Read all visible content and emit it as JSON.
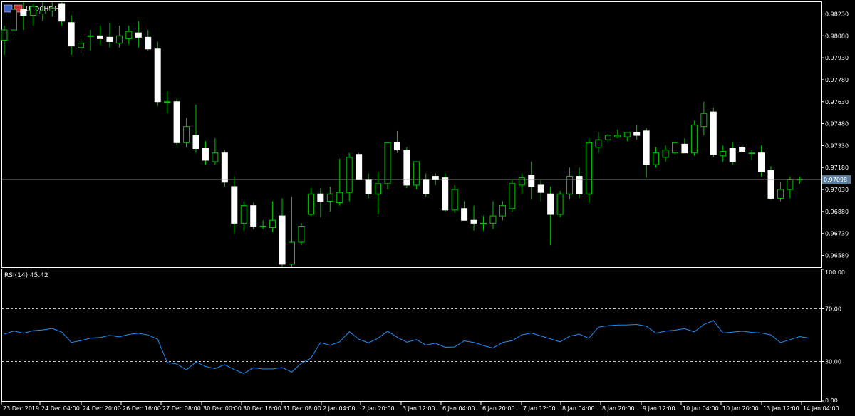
{
  "window": {
    "title": "USDCHF,H4"
  },
  "indicator": {
    "label": "RSI(14) 45.42"
  },
  "colors": {
    "background": "#000000",
    "bull_wick": "#00c800",
    "bear_fill": "#ffffff",
    "rsi_line": "#1e90ff",
    "price_line": "#a0a0a0",
    "price_tag": "#5f7f9f"
  },
  "chart_data": [
    {
      "type": "candlestick",
      "title": "USDCHF,H4",
      "ylim": [
        0.965,
        0.9831
      ],
      "yticks": [
        {
          "value": 0.9823,
          "label": "0.98230"
        },
        {
          "value": 0.9808,
          "label": "0.98080"
        },
        {
          "value": 0.9793,
          "label": "0.97930"
        },
        {
          "value": 0.9778,
          "label": "0.97780"
        },
        {
          "value": 0.9763,
          "label": "0.97630"
        },
        {
          "value": 0.9748,
          "label": "0.97480"
        },
        {
          "value": 0.9733,
          "label": "0.97330"
        },
        {
          "value": 0.9718,
          "label": "0.97180"
        },
        {
          "value": 0.9703,
          "label": "0.97030"
        },
        {
          "value": 0.9688,
          "label": "0.96880"
        },
        {
          "value": 0.9673,
          "label": "0.96730"
        },
        {
          "value": 0.9658,
          "label": "0.96580"
        }
      ],
      "current_price": {
        "value": 0.97098,
        "label": "0.97098"
      },
      "x_labels": [
        "23 Dec 2019",
        "24 Dec 04:00",
        "24 Dec 20:00",
        "26 Dec 16:00",
        "27 Dec 08:00",
        "30 Dec 00:00",
        "30 Dec 16:00",
        "31 Dec 08:00",
        "2 Jan 04:00",
        "2 Jan 20:00",
        "3 Jan 12:00",
        "6 Jan 04:00",
        "6 Jan 20:00",
        "7 Jan 12:00",
        "8 Jan 04:00",
        "8 Jan 20:00",
        "9 Jan 12:00",
        "10 Jan 04:00",
        "10 Jan 20:00",
        "13 Jan 12:00",
        "14 Jan 04:00"
      ],
      "candles": [
        {
          "o": 0.9805,
          "h": 0.9815,
          "l": 0.9795,
          "c": 0.9812
        },
        {
          "o": 0.9812,
          "h": 0.983,
          "l": 0.9808,
          "c": 0.9826
        },
        {
          "o": 0.9826,
          "h": 0.9831,
          "l": 0.9812,
          "c": 0.9822
        },
        {
          "o": 0.9822,
          "h": 0.983,
          "l": 0.9815,
          "c": 0.9828
        },
        {
          "o": 0.9823,
          "h": 0.9831,
          "l": 0.9818,
          "c": 0.9825
        },
        {
          "o": 0.9825,
          "h": 0.9831,
          "l": 0.9821,
          "c": 0.9827
        },
        {
          "o": 0.983,
          "h": 0.9831,
          "l": 0.9815,
          "c": 0.9818
        },
        {
          "o": 0.9817,
          "h": 0.9822,
          "l": 0.9795,
          "c": 0.9801
        },
        {
          "o": 0.98,
          "h": 0.9806,
          "l": 0.9796,
          "c": 0.9803
        },
        {
          "o": 0.9808,
          "h": 0.9812,
          "l": 0.9798,
          "c": 0.9808
        },
        {
          "o": 0.9808,
          "h": 0.9815,
          "l": 0.9802,
          "c": 0.9806
        },
        {
          "o": 0.9807,
          "h": 0.9817,
          "l": 0.98,
          "c": 0.9804
        },
        {
          "o": 0.9803,
          "h": 0.9815,
          "l": 0.98,
          "c": 0.9808
        },
        {
          "o": 0.9806,
          "h": 0.9815,
          "l": 0.9802,
          "c": 0.9811
        },
        {
          "o": 0.981,
          "h": 0.9818,
          "l": 0.98,
          "c": 0.9807
        },
        {
          "o": 0.9807,
          "h": 0.9812,
          "l": 0.9798,
          "c": 0.9799
        },
        {
          "o": 0.9799,
          "h": 0.9804,
          "l": 0.976,
          "c": 0.9763
        },
        {
          "o": 0.9763,
          "h": 0.977,
          "l": 0.9755,
          "c": 0.9763
        },
        {
          "o": 0.9763,
          "h": 0.9765,
          "l": 0.9733,
          "c": 0.9735
        },
        {
          "o": 0.9735,
          "h": 0.9752,
          "l": 0.9732,
          "c": 0.9746
        },
        {
          "o": 0.974,
          "h": 0.9761,
          "l": 0.9728,
          "c": 0.9731
        },
        {
          "o": 0.9731,
          "h": 0.9736,
          "l": 0.972,
          "c": 0.9723
        },
        {
          "o": 0.9722,
          "h": 0.9738,
          "l": 0.972,
          "c": 0.9728
        },
        {
          "o": 0.9728,
          "h": 0.973,
          "l": 0.9705,
          "c": 0.9708
        },
        {
          "o": 0.9705,
          "h": 0.9712,
          "l": 0.9673,
          "c": 0.968
        },
        {
          "o": 0.968,
          "h": 0.9695,
          "l": 0.9675,
          "c": 0.9692
        },
        {
          "o": 0.9692,
          "h": 0.9694,
          "l": 0.9676,
          "c": 0.9678
        },
        {
          "o": 0.9678,
          "h": 0.9682,
          "l": 0.9676,
          "c": 0.9678
        },
        {
          "o": 0.9677,
          "h": 0.9695,
          "l": 0.9674,
          "c": 0.9682
        },
        {
          "o": 0.9685,
          "h": 0.9697,
          "l": 0.965,
          "c": 0.9652
        },
        {
          "o": 0.9652,
          "h": 0.9698,
          "l": 0.965,
          "c": 0.9667
        },
        {
          "o": 0.9667,
          "h": 0.968,
          "l": 0.9665,
          "c": 0.9678
        },
        {
          "o": 0.9686,
          "h": 0.9704,
          "l": 0.9685,
          "c": 0.97
        },
        {
          "o": 0.97,
          "h": 0.9704,
          "l": 0.9684,
          "c": 0.9695
        },
        {
          "o": 0.9695,
          "h": 0.9705,
          "l": 0.9688,
          "c": 0.97
        },
        {
          "o": 0.9694,
          "h": 0.9724,
          "l": 0.9692,
          "c": 0.9701
        },
        {
          "o": 0.9701,
          "h": 0.9728,
          "l": 0.9695,
          "c": 0.9725
        },
        {
          "o": 0.9727,
          "h": 0.9728,
          "l": 0.971,
          "c": 0.971
        },
        {
          "o": 0.971,
          "h": 0.9714,
          "l": 0.9697,
          "c": 0.97
        },
        {
          "o": 0.97,
          "h": 0.9715,
          "l": 0.9686,
          "c": 0.9707
        },
        {
          "o": 0.9707,
          "h": 0.973,
          "l": 0.9703,
          "c": 0.9735
        },
        {
          "o": 0.9735,
          "h": 0.9743,
          "l": 0.9728,
          "c": 0.973
        },
        {
          "o": 0.973,
          "h": 0.9732,
          "l": 0.9704,
          "c": 0.9706
        },
        {
          "o": 0.9706,
          "h": 0.9722,
          "l": 0.9703,
          "c": 0.9722
        },
        {
          "o": 0.971,
          "h": 0.9714,
          "l": 0.9698,
          "c": 0.97
        },
        {
          "o": 0.9712,
          "h": 0.9714,
          "l": 0.9706,
          "c": 0.971
        },
        {
          "o": 0.9711,
          "h": 0.9714,
          "l": 0.9688,
          "c": 0.9689
        },
        {
          "o": 0.9689,
          "h": 0.9706,
          "l": 0.9687,
          "c": 0.9703
        },
        {
          "o": 0.969,
          "h": 0.9695,
          "l": 0.9682,
          "c": 0.9682
        },
        {
          "o": 0.9682,
          "h": 0.9692,
          "l": 0.9675,
          "c": 0.968
        },
        {
          "o": 0.968,
          "h": 0.9685,
          "l": 0.9675,
          "c": 0.968
        },
        {
          "o": 0.968,
          "h": 0.9695,
          "l": 0.9676,
          "c": 0.9685
        },
        {
          "o": 0.9685,
          "h": 0.9695,
          "l": 0.9682,
          "c": 0.9692
        },
        {
          "o": 0.969,
          "h": 0.971,
          "l": 0.9688,
          "c": 0.9707
        },
        {
          "o": 0.9706,
          "h": 0.9714,
          "l": 0.97,
          "c": 0.9711
        },
        {
          "o": 0.9713,
          "h": 0.9722,
          "l": 0.9696,
          "c": 0.9705
        },
        {
          "o": 0.9706,
          "h": 0.971,
          "l": 0.9695,
          "c": 0.9701
        },
        {
          "o": 0.97,
          "h": 0.9705,
          "l": 0.9665,
          "c": 0.9686
        },
        {
          "o": 0.9686,
          "h": 0.9702,
          "l": 0.9684,
          "c": 0.97
        },
        {
          "o": 0.97,
          "h": 0.9718,
          "l": 0.9696,
          "c": 0.9712
        },
        {
          "o": 0.9712,
          "h": 0.9718,
          "l": 0.9697,
          "c": 0.97
        },
        {
          "o": 0.97,
          "h": 0.9738,
          "l": 0.9694,
          "c": 0.9735
        },
        {
          "o": 0.9732,
          "h": 0.9742,
          "l": 0.9728,
          "c": 0.9737
        },
        {
          "o": 0.9737,
          "h": 0.9741,
          "l": 0.9735,
          "c": 0.974
        },
        {
          "o": 0.9739,
          "h": 0.9744,
          "l": 0.9738,
          "c": 0.974
        },
        {
          "o": 0.9739,
          "h": 0.9741,
          "l": 0.9736,
          "c": 0.9742
        },
        {
          "o": 0.9742,
          "h": 0.9747,
          "l": 0.9737,
          "c": 0.974
        },
        {
          "o": 0.9743,
          "h": 0.9745,
          "l": 0.9711,
          "c": 0.972
        },
        {
          "o": 0.972,
          "h": 0.9732,
          "l": 0.9718,
          "c": 0.9728
        },
        {
          "o": 0.9725,
          "h": 0.9733,
          "l": 0.9722,
          "c": 0.973
        },
        {
          "o": 0.9728,
          "h": 0.9737,
          "l": 0.9727,
          "c": 0.9735
        },
        {
          "o": 0.9734,
          "h": 0.9738,
          "l": 0.9728,
          "c": 0.9728
        },
        {
          "o": 0.9728,
          "h": 0.975,
          "l": 0.9726,
          "c": 0.9747
        },
        {
          "o": 0.9746,
          "h": 0.9763,
          "l": 0.974,
          "c": 0.9755
        },
        {
          "o": 0.9756,
          "h": 0.9759,
          "l": 0.9725,
          "c": 0.9727
        },
        {
          "o": 0.9726,
          "h": 0.9733,
          "l": 0.9722,
          "c": 0.9729
        },
        {
          "o": 0.9731,
          "h": 0.9735,
          "l": 0.972,
          "c": 0.9722
        },
        {
          "o": 0.9732,
          "h": 0.9733,
          "l": 0.9728,
          "c": 0.9729
        },
        {
          "o": 0.9728,
          "h": 0.973,
          "l": 0.9723,
          "c": 0.9728
        },
        {
          "o": 0.9728,
          "h": 0.9733,
          "l": 0.9712,
          "c": 0.9715
        },
        {
          "o": 0.9716,
          "h": 0.9719,
          "l": 0.9696,
          "c": 0.9697
        },
        {
          "o": 0.9697,
          "h": 0.9708,
          "l": 0.9695,
          "c": 0.9703
        },
        {
          "o": 0.9703,
          "h": 0.9712,
          "l": 0.9697,
          "c": 0.971
        },
        {
          "o": 0.971,
          "h": 0.9712,
          "l": 0.9707,
          "c": 0.971
        }
      ]
    },
    {
      "type": "line",
      "title": "RSI(14) 45.42",
      "ylim": [
        0,
        100
      ],
      "yticks": [
        {
          "value": 100,
          "label": "100.00"
        },
        {
          "value": 70,
          "label": "70.00"
        },
        {
          "value": 30,
          "label": "30.00"
        },
        {
          "value": 0,
          "label": "0.00"
        }
      ],
      "levels": [
        70,
        30
      ],
      "series": [
        {
          "values": [
            50.8,
            53.2,
            51.5,
            53.4,
            54.0,
            55.1,
            52.3,
            44.5,
            45.9,
            47.8,
            48.2,
            49.8,
            48.7,
            50.6,
            51.4,
            50.1,
            47.0,
            29.3,
            28.1,
            23.6,
            29.7,
            26.3,
            24.6,
            27.6,
            23.9,
            20.9,
            25.3,
            24.3,
            24.4,
            25.4,
            22.0,
            28.7,
            32.6,
            44.4,
            42.4,
            45.0,
            52.7,
            47.0,
            44.1,
            47.7,
            53.0,
            48.5,
            44.7,
            46.6,
            42.5,
            43.9,
            40.8,
            41.1,
            45.7,
            44.5,
            42.1,
            40.2,
            44.5,
            45.8,
            50.2,
            51.6,
            49.4,
            47.2,
            44.9,
            49.2,
            50.8,
            47.6,
            56.1,
            57.2,
            57.7,
            57.8,
            58.1,
            56.8,
            51.5,
            53.1,
            53.8,
            55.0,
            52.5,
            58.1,
            61.1,
            51.6,
            52.3,
            53.0,
            52.1,
            51.7,
            50.2,
            44.3,
            46.6,
            48.9,
            47.8
          ]
        }
      ]
    }
  ]
}
